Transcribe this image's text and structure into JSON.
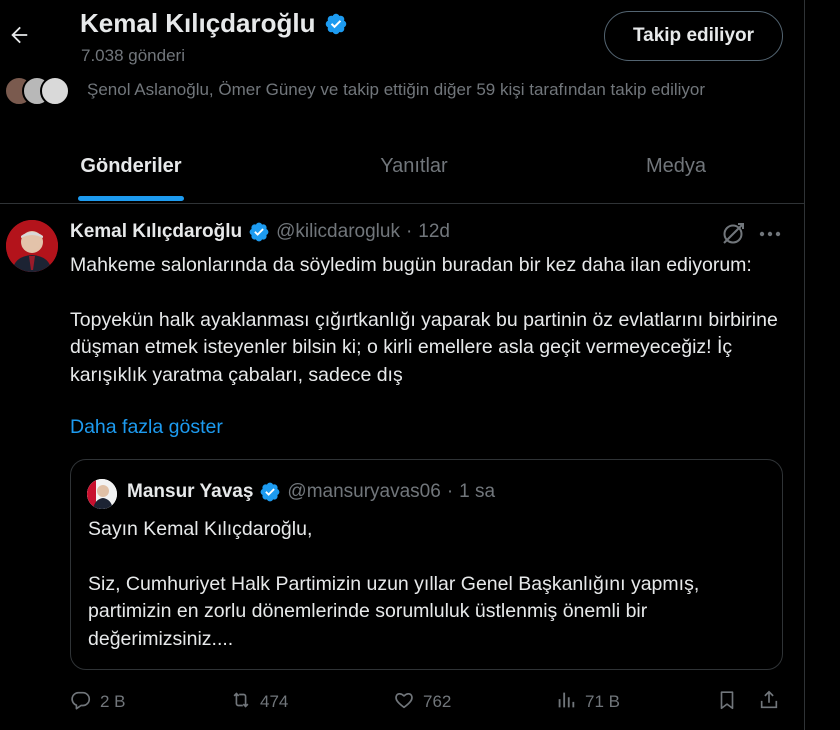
{
  "header": {
    "title": "Kemal Kılıçdaroğlu",
    "post_count": "7.038 gönderi",
    "follow_button": "Takip ediliyor",
    "followers_known": "Şenol Aslanoğlu, Ömer Güney ve takip ettiğin diğer 59 kişi tarafından takip ediliyor"
  },
  "tabs": [
    {
      "label": "Gönderiler",
      "active": true
    },
    {
      "label": "Yanıtlar",
      "active": false
    },
    {
      "label": "Medya",
      "active": false
    }
  ],
  "tweet": {
    "name": "Kemal Kılıçdaroğlu",
    "handle": "@kilicdarogluk",
    "separator": "·",
    "time": "12d",
    "paragraph1": "Mahkeme salonlarında da söyledim bugün buradan bir kez daha ilan ediyorum:",
    "paragraph2": "Topyekün halk ayaklanması çığırtkanlığı yaparak bu partinin öz evlatlarını birbirine düşman etmek isteyenler bilsin ki; o kirli emellere asla geçit vermeyeceğiz! İç karışıklık yaratma çabaları, sadece dış",
    "show_more": "Daha fazla göster",
    "quote": {
      "name": "Mansur Yavaş",
      "handle": "@mansuryavas06",
      "separator": "·",
      "time": "1 sa",
      "paragraph1": "Sayın Kemal Kılıçdaroğlu,",
      "paragraph2": "Siz, Cumhuriyet Halk Partimizin uzun yıllar Genel Başkanlığını yapmış, partimizin en zorlu dönemlerinde sorumluluk üstlenmiş önemli bir değerimizsiniz...."
    },
    "actions": {
      "replies": "2 B",
      "reposts": "474",
      "likes": "762",
      "views": "71 B"
    }
  },
  "colors": {
    "background": "#000000",
    "accent": "#1d9bf0",
    "text": "#e7e9ea",
    "muted": "#71767b",
    "border": "#2f3336"
  },
  "icons": [
    "back-arrow-icon",
    "verified-badge-icon",
    "grok-icon",
    "more-icon",
    "reply-icon",
    "repost-icon",
    "like-icon",
    "views-icon",
    "bookmark-icon",
    "share-icon"
  ]
}
